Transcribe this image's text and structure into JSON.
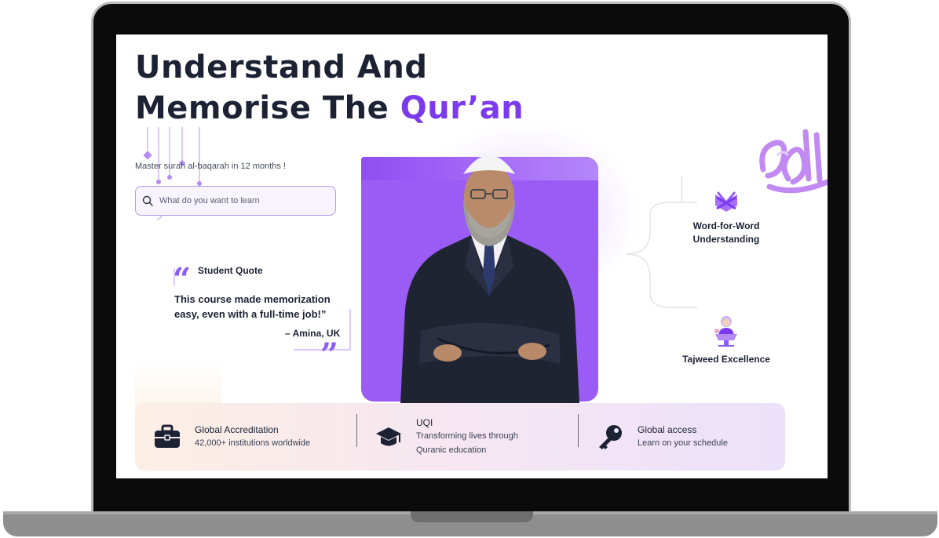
{
  "hero": {
    "title_line1": "Understand And",
    "title_line2_prefix": "Memorise The ",
    "title_line2_accent": "Qur’an",
    "tagline": "Master surah al-baqarah in 12 months !"
  },
  "search": {
    "placeholder": "What do you want to learn"
  },
  "quote": {
    "title": "Student Quote",
    "text": "This course made memorization easy, even with a full-time job!”",
    "author": "– Amina, UK"
  },
  "features": [
    {
      "label": "Word-for-Word Understanding",
      "icon": "open-quran-book-icon"
    },
    {
      "label": "Tajweed Excellence",
      "icon": "reader-at-lectern-icon"
    }
  ],
  "info_bar": [
    {
      "title": "Global Accreditation",
      "sub": "42,000+ institutions worldwide",
      "icon": "briefcase-icon"
    },
    {
      "title": "UQI",
      "sub": "Transforming lives through Quranic education",
      "icon": "graduation-cap-icon"
    },
    {
      "title": "Global access",
      "sub": "Learn on your schedule",
      "icon": "key-icon"
    }
  ],
  "colors": {
    "accent": "#7c3aed",
    "heading": "#1c2234",
    "card_purple": "#9b5cf6"
  }
}
